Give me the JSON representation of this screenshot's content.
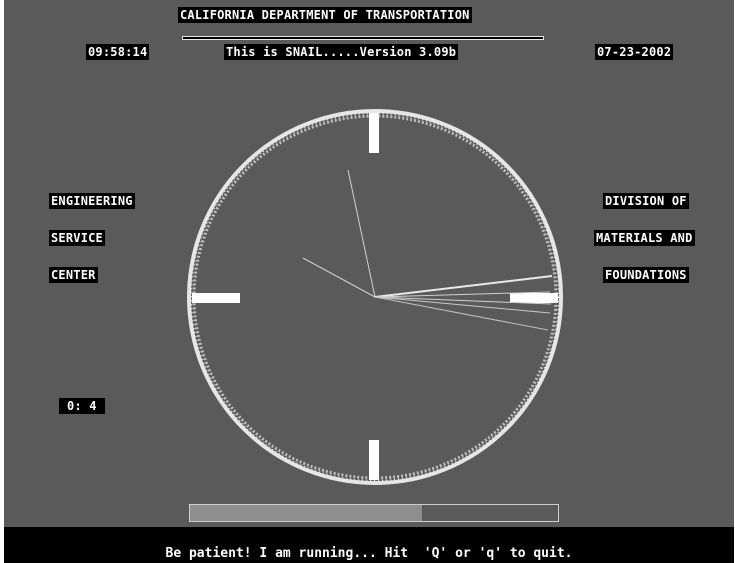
{
  "header": {
    "title": "CALIFORNIA DEPARTMENT OF TRANSPORTATION",
    "time": "09:58:14",
    "version": "This is SNAIL.....Version 3.09b",
    "date": "07-23-2002"
  },
  "left_panel": {
    "lines": [
      "ENGINEERING",
      "SERVICE",
      "CENTER"
    ],
    "counter": "0: 4"
  },
  "right_panel": {
    "lines": [
      "DIVISION OF",
      "MATERIALS AND",
      "FOUNDATIONS"
    ]
  },
  "progress": {
    "fraction": 0.63
  },
  "status": {
    "message": "Be patient! I am running... Hit  'Q' or 'q' to quit."
  },
  "colors": {
    "background": "#5a5a5a",
    "label_bg": "#000000",
    "label_text": "#ffffff",
    "dial_ring": "#e6e6e6",
    "progress_fill": "#8e8e8e"
  }
}
